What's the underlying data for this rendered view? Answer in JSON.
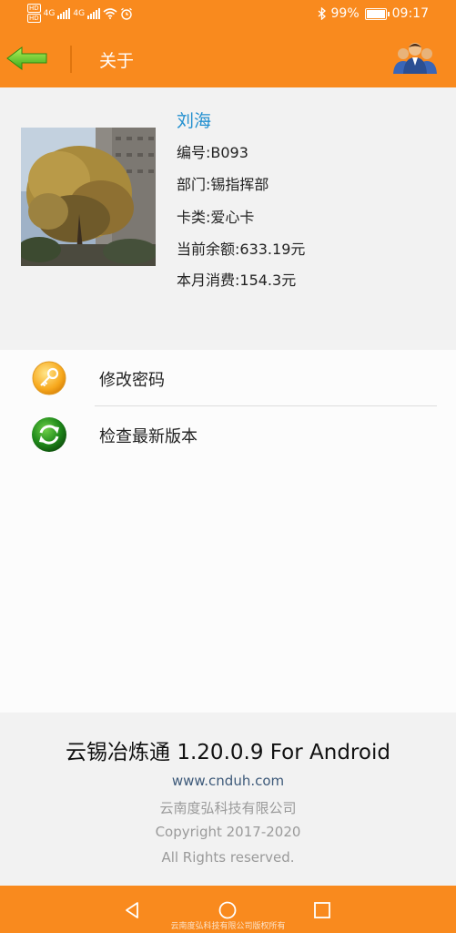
{
  "status_bar": {
    "hd_top": "HD",
    "hd_bottom": "HD",
    "net1": "4G",
    "net2": "4G",
    "battery_percent_text": "99%",
    "battery_level": 0.99,
    "time": "09:17"
  },
  "top_bar": {
    "title": "关于",
    "icons": {
      "back": "back-arrow-icon",
      "users": "users-group-icon"
    }
  },
  "profile": {
    "name": "刘海",
    "employee_no": "编号:B093",
    "department": "部门:锡指挥部",
    "card_type": "卡类:爱心卡",
    "balance": "当前余额:633.19元",
    "monthly_spend": "本月消费:154.3元"
  },
  "menu": [
    {
      "label": "修改密码",
      "icon": "key-icon"
    },
    {
      "label": "检查最新版本",
      "icon": "refresh-icon"
    }
  ],
  "footer": {
    "app_title": "云锡冶炼通 1.20.0.9 For Android",
    "website": "www.cnduh.com",
    "company": "云南度弘科技有限公司",
    "copyright": "Copyright 2017-2020",
    "rights": "All Rights reserved."
  },
  "nav_bar": {
    "watermark": "云南度弘科技有限公司版权所有"
  },
  "colors": {
    "accent": "#f98a1e",
    "name_blue": "#2390d0",
    "background": "#f2f2f2"
  }
}
